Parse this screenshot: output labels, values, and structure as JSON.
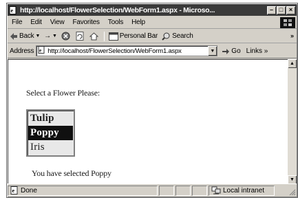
{
  "window": {
    "title": "http://localhost/FlowerSelection/WebForm1.aspx - Microso...",
    "minimize_glyph": "–",
    "maximize_glyph": "□",
    "close_glyph": "×"
  },
  "menu": {
    "items": [
      {
        "label": "File"
      },
      {
        "label": "Edit"
      },
      {
        "label": "View"
      },
      {
        "label": "Favorites"
      },
      {
        "label": "Tools"
      },
      {
        "label": "Help"
      }
    ]
  },
  "toolbar": {
    "back_label": "Back",
    "forward_glyph": "→",
    "personal_bar_label": "Personal Bar",
    "search_label": "Search",
    "overflow_glyph": "»"
  },
  "address": {
    "label": "Address",
    "url": "http://localhost/FlowerSelection/WebForm1.aspx",
    "go_label": "Go",
    "links_label": "Links »"
  },
  "page": {
    "prompt": "Select a Flower Please:",
    "flowers": [
      {
        "label": "Tulip",
        "selected": false
      },
      {
        "label": "Poppy",
        "selected": true
      },
      {
        "label": "Iris",
        "selected": false
      }
    ],
    "result": "You have selected Poppy"
  },
  "status": {
    "text": "Done",
    "zone": "Local intranet"
  }
}
